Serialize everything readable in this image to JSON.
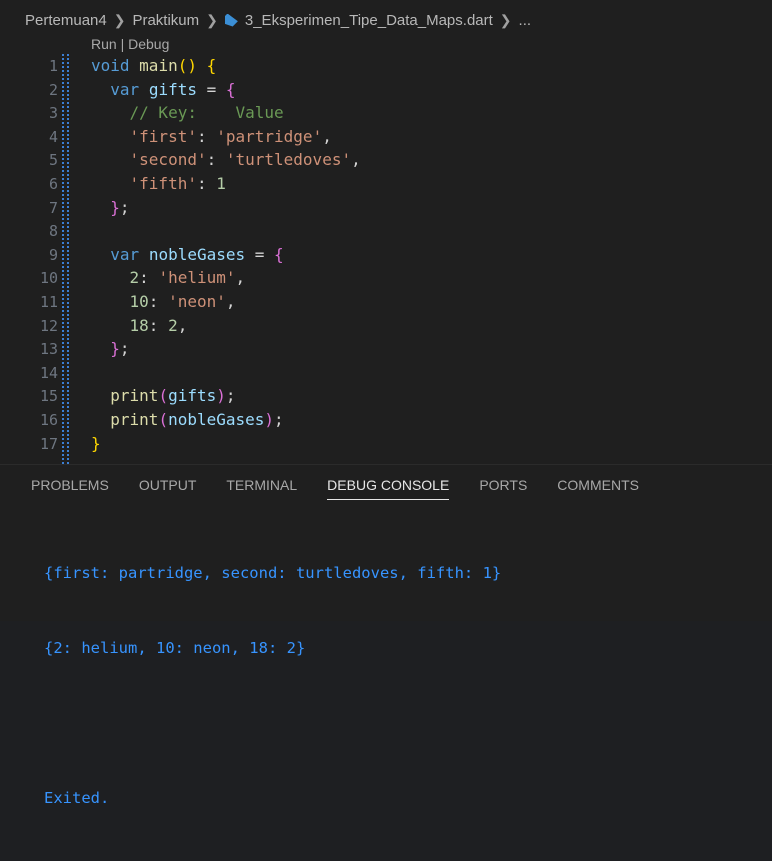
{
  "breadcrumb": {
    "items": [
      "Pertemuan4",
      "Praktikum"
    ],
    "file": "3_Eksperimen_Tipe_Data_Maps.dart",
    "tail": "..."
  },
  "editor": {
    "codelens": "Run | Debug",
    "line_numbers": [
      "1",
      "2",
      "3",
      "4",
      "5",
      "6",
      "7",
      "8",
      "9",
      "10",
      "11",
      "12",
      "13",
      "14",
      "15",
      "16",
      "17"
    ],
    "lines": [
      {
        "p": [
          [
            "kw",
            "void"
          ],
          [
            "punc",
            " "
          ],
          [
            "fn",
            "main"
          ],
          [
            "brace1",
            "()"
          ],
          [
            "punc",
            " "
          ],
          [
            "brace1",
            "{"
          ]
        ]
      },
      {
        "p": [
          [
            "punc",
            "  "
          ],
          [
            "kw",
            "var"
          ],
          [
            "punc",
            " "
          ],
          [
            "var",
            "gifts"
          ],
          [
            "punc",
            " = "
          ],
          [
            "brace2",
            "{"
          ]
        ]
      },
      {
        "p": [
          [
            "punc",
            "    "
          ],
          [
            "cmt",
            "// Key:    Value"
          ]
        ]
      },
      {
        "p": [
          [
            "punc",
            "    "
          ],
          [
            "str",
            "'first'"
          ],
          [
            "punc",
            ": "
          ],
          [
            "str",
            "'partridge'"
          ],
          [
            "punc",
            ","
          ]
        ]
      },
      {
        "p": [
          [
            "punc",
            "    "
          ],
          [
            "str",
            "'second'"
          ],
          [
            "punc",
            ": "
          ],
          [
            "str",
            "'turtledoves'"
          ],
          [
            "punc",
            ","
          ]
        ]
      },
      {
        "p": [
          [
            "punc",
            "    "
          ],
          [
            "str",
            "'fifth'"
          ],
          [
            "punc",
            ": "
          ],
          [
            "num",
            "1"
          ]
        ]
      },
      {
        "p": [
          [
            "punc",
            "  "
          ],
          [
            "brace2",
            "}"
          ],
          [
            "punc",
            ";"
          ]
        ]
      },
      {
        "p": []
      },
      {
        "p": [
          [
            "punc",
            "  "
          ],
          [
            "kw",
            "var"
          ],
          [
            "punc",
            " "
          ],
          [
            "var",
            "nobleGases"
          ],
          [
            "punc",
            " = "
          ],
          [
            "brace2",
            "{"
          ]
        ]
      },
      {
        "p": [
          [
            "punc",
            "    "
          ],
          [
            "num",
            "2"
          ],
          [
            "punc",
            ": "
          ],
          [
            "str",
            "'helium'"
          ],
          [
            "punc",
            ","
          ]
        ]
      },
      {
        "p": [
          [
            "punc",
            "    "
          ],
          [
            "num",
            "10"
          ],
          [
            "punc",
            ": "
          ],
          [
            "str",
            "'neon'"
          ],
          [
            "punc",
            ","
          ]
        ]
      },
      {
        "p": [
          [
            "punc",
            "    "
          ],
          [
            "num",
            "18"
          ],
          [
            "punc",
            ": "
          ],
          [
            "num",
            "2"
          ],
          [
            "punc",
            ","
          ]
        ]
      },
      {
        "p": [
          [
            "punc",
            "  "
          ],
          [
            "brace2",
            "}"
          ],
          [
            "punc",
            ";"
          ]
        ]
      },
      {
        "p": []
      },
      {
        "p": [
          [
            "punc",
            "  "
          ],
          [
            "fn",
            "print"
          ],
          [
            "brace2",
            "("
          ],
          [
            "var",
            "gifts"
          ],
          [
            "brace2",
            ")"
          ],
          [
            "punc",
            ";"
          ]
        ]
      },
      {
        "p": [
          [
            "punc",
            "  "
          ],
          [
            "fn",
            "print"
          ],
          [
            "brace2",
            "("
          ],
          [
            "var",
            "nobleGases"
          ],
          [
            "brace2",
            ")"
          ],
          [
            "punc",
            ";"
          ]
        ]
      },
      {
        "p": [
          [
            "brace1",
            "}"
          ]
        ]
      }
    ]
  },
  "panel": {
    "tabs": [
      "PROBLEMS",
      "OUTPUT",
      "TERMINAL",
      "DEBUG CONSOLE",
      "PORTS",
      "COMMENTS"
    ],
    "active_tab": "DEBUG CONSOLE",
    "console_lines": [
      "{first: partridge, second: turtledoves, fifth: 1}",
      "{2: helium, 10: neon, 18: 2}",
      "",
      "Exited."
    ]
  },
  "colors": {
    "keyword": "#569cd6",
    "function": "#dcdcaa",
    "string": "#ce9178",
    "number": "#b5cea8",
    "comment": "#6a9955",
    "console_text": "#3794ff"
  }
}
